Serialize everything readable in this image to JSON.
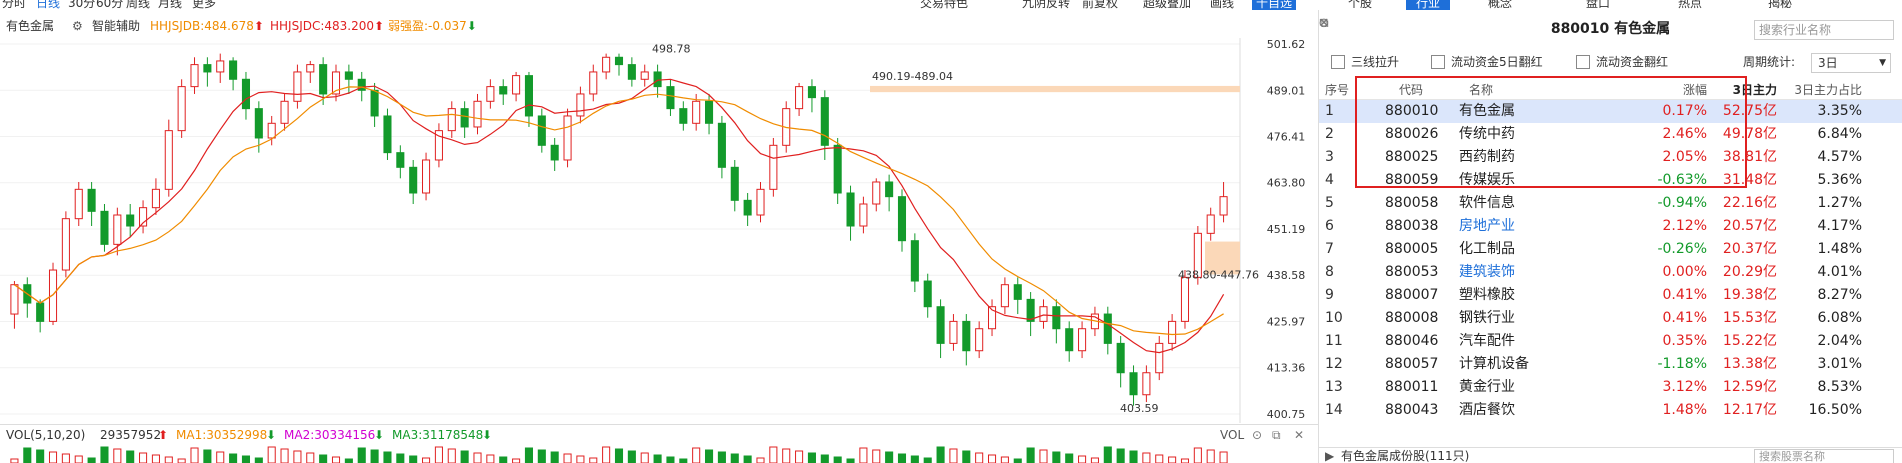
{
  "top_tabs": [
    "分时",
    "日线",
    "30分",
    "60分",
    "周线",
    "月线",
    "更多"
  ],
  "top_tab_active": 1,
  "top_tools": [
    "交易特色",
    "九阴反转",
    "前复权",
    "超级叠加",
    "画线",
    "十自选"
  ],
  "right_tabs": [
    "个股",
    "行业",
    "概念",
    "盘口",
    "热点",
    "揭秘"
  ],
  "right_tab_active": 1,
  "chart_header": {
    "name": "有色金属",
    "assist": "智能辅助",
    "ind1": "HHJSJDB:484.678",
    "ind2": "HHJSJDC:483.200",
    "ind3": "弱强盈:-0.037"
  },
  "vol_header": {
    "label": "VOL(5,10,20)",
    "vol": "29357952",
    "ma1": "MA1:30352998",
    "ma2": "MA2:30334156",
    "ma3": "MA3:31178548",
    "right_label": "VOL"
  },
  "chart_data": {
    "type": "candlestick",
    "price_axis": [
      "501.62",
      "489.01",
      "476.41",
      "463.80",
      "451.19",
      "438.58",
      "425.97",
      "413.36",
      "400.75"
    ],
    "ylim": [
      400.75,
      501.62
    ],
    "annotations": {
      "high_label": "498.78",
      "low_label": "403.59",
      "zone1": "490.19-489.04",
      "zone2": "438.80-447.76"
    },
    "candles": [
      [
        428,
        436,
        424,
        437
      ],
      [
        436,
        431,
        427,
        438
      ],
      [
        431,
        426,
        423,
        432
      ],
      [
        426,
        440,
        425,
        442
      ],
      [
        440,
        454,
        438,
        456
      ],
      [
        454,
        462,
        452,
        464
      ],
      [
        462,
        456,
        452,
        464
      ],
      [
        456,
        447,
        445,
        458
      ],
      [
        447,
        455,
        444,
        457
      ],
      [
        455,
        452,
        449,
        458
      ],
      [
        452,
        457,
        450,
        459
      ],
      [
        457,
        462,
        455,
        465
      ],
      [
        462,
        478,
        460,
        481
      ],
      [
        478,
        490,
        476,
        492
      ],
      [
        490,
        496,
        488,
        498
      ],
      [
        496,
        494,
        490,
        498
      ],
      [
        494,
        497,
        491,
        499
      ],
      [
        497,
        492,
        489,
        498
      ],
      [
        492,
        484,
        481,
        494
      ],
      [
        484,
        476,
        472,
        486
      ],
      [
        476,
        480,
        474,
        482
      ],
      [
        480,
        486,
        478,
        488
      ],
      [
        486,
        494,
        484,
        496
      ],
      [
        494,
        496,
        491,
        497
      ],
      [
        496,
        488,
        485,
        498
      ],
      [
        488,
        494,
        486,
        496
      ],
      [
        494,
        492,
        488,
        496
      ],
      [
        492,
        489,
        486,
        494
      ],
      [
        489,
        482,
        479,
        491
      ],
      [
        482,
        472,
        470,
        484
      ],
      [
        472,
        468,
        465,
        474
      ],
      [
        468,
        461,
        458,
        470
      ],
      [
        461,
        470,
        459,
        472
      ],
      [
        470,
        478,
        468,
        480
      ],
      [
        478,
        484,
        476,
        486
      ],
      [
        484,
        479,
        476,
        486
      ],
      [
        479,
        486,
        477,
        488
      ],
      [
        486,
        490,
        484,
        492
      ],
      [
        490,
        488,
        485,
        492
      ],
      [
        488,
        493,
        486,
        494
      ],
      [
        493,
        482,
        479,
        494
      ],
      [
        482,
        474,
        472,
        484
      ],
      [
        474,
        470,
        467,
        476
      ],
      [
        470,
        482,
        468,
        484
      ],
      [
        482,
        488,
        480,
        490
      ],
      [
        488,
        494,
        486,
        496
      ],
      [
        494,
        498,
        492,
        499
      ],
      [
        498,
        496,
        493,
        499
      ],
      [
        496,
        492,
        490,
        498
      ],
      [
        492,
        494,
        490,
        496
      ],
      [
        494,
        490,
        487,
        496
      ],
      [
        490,
        484,
        482,
        492
      ],
      [
        484,
        480,
        478,
        486
      ],
      [
        480,
        486,
        478,
        488
      ],
      [
        486,
        480,
        477,
        488
      ],
      [
        480,
        468,
        465,
        482
      ],
      [
        468,
        459,
        456,
        470
      ],
      [
        459,
        455,
        452,
        461
      ],
      [
        455,
        462,
        453,
        464
      ],
      [
        462,
        474,
        460,
        476
      ],
      [
        474,
        484,
        472,
        486
      ],
      [
        484,
        490,
        482,
        491
      ],
      [
        490,
        487,
        483,
        492
      ],
      [
        487,
        474,
        470,
        489
      ],
      [
        474,
        461,
        458,
        476
      ],
      [
        461,
        452,
        448,
        463
      ],
      [
        452,
        458,
        450,
        460
      ],
      [
        458,
        464,
        456,
        465
      ],
      [
        464,
        460,
        456,
        466
      ],
      [
        460,
        448,
        445,
        462
      ],
      [
        448,
        437,
        434,
        450
      ],
      [
        437,
        430,
        427,
        439
      ],
      [
        430,
        420,
        416,
        432
      ],
      [
        420,
        426,
        418,
        428
      ],
      [
        426,
        418,
        414,
        428
      ],
      [
        418,
        424,
        416,
        426
      ],
      [
        424,
        430,
        422,
        432
      ],
      [
        430,
        436,
        428,
        438
      ],
      [
        436,
        432,
        428,
        438
      ],
      [
        432,
        426,
        422,
        434
      ],
      [
        426,
        430,
        424,
        432
      ],
      [
        430,
        424,
        420,
        432
      ],
      [
        424,
        418,
        415,
        426
      ],
      [
        418,
        424,
        416,
        426
      ],
      [
        424,
        428,
        422,
        430
      ],
      [
        428,
        420,
        417,
        430
      ],
      [
        420,
        412,
        408,
        422
      ],
      [
        412,
        406,
        403,
        414
      ],
      [
        406,
        412,
        404,
        414
      ],
      [
        412,
        420,
        410,
        422
      ],
      [
        420,
        426,
        418,
        428
      ],
      [
        426,
        438,
        424,
        440
      ],
      [
        438,
        450,
        436,
        452
      ],
      [
        450,
        455,
        448,
        457
      ],
      [
        455,
        460,
        453,
        464
      ]
    ]
  },
  "right_panel": {
    "title": "880010 有色金属",
    "search_placeholder": "搜索行业名称",
    "filters": [
      "三线拉升",
      "流动资金5日翻红",
      "流动资金翻红"
    ],
    "period_label": "周期统计:",
    "period_value": "3日",
    "headers": [
      "序号",
      "代码",
      "名称",
      "涨幅",
      "3日主力",
      "3日主力占比"
    ],
    "rows": [
      {
        "idx": "1",
        "code": "880010",
        "name": "有色金属",
        "chg": "0.17%",
        "net": "52.75亿",
        "pct": "3.35%",
        "dir": "up",
        "link": false
      },
      {
        "idx": "2",
        "code": "880026",
        "name": "传统中药",
        "chg": "2.46%",
        "net": "49.78亿",
        "pct": "6.84%",
        "dir": "up",
        "link": false
      },
      {
        "idx": "3",
        "code": "880025",
        "name": "西药制药",
        "chg": "2.05%",
        "net": "38.81亿",
        "pct": "4.57%",
        "dir": "up",
        "link": false
      },
      {
        "idx": "4",
        "code": "880059",
        "name": "传媒娱乐",
        "chg": "-0.63%",
        "net": "31.48亿",
        "pct": "5.36%",
        "dir": "down",
        "link": false
      },
      {
        "idx": "5",
        "code": "880058",
        "name": "软件信息",
        "chg": "-0.94%",
        "net": "22.16亿",
        "pct": "1.27%",
        "dir": "down",
        "link": false
      },
      {
        "idx": "6",
        "code": "880038",
        "name": "房地产业",
        "chg": "2.12%",
        "net": "20.57亿",
        "pct": "4.17%",
        "dir": "up",
        "link": true
      },
      {
        "idx": "7",
        "code": "880005",
        "name": "化工制品",
        "chg": "-0.26%",
        "net": "20.37亿",
        "pct": "1.48%",
        "dir": "down",
        "link": false
      },
      {
        "idx": "8",
        "code": "880053",
        "name": "建筑装饰",
        "chg": "0.00%",
        "net": "20.29亿",
        "pct": "4.01%",
        "dir": "up",
        "link": true
      },
      {
        "idx": "9",
        "code": "880007",
        "name": "塑料橡胶",
        "chg": "0.41%",
        "net": "19.38亿",
        "pct": "8.27%",
        "dir": "up",
        "link": false
      },
      {
        "idx": "10",
        "code": "880008",
        "name": "钢铁行业",
        "chg": "0.41%",
        "net": "15.53亿",
        "pct": "6.08%",
        "dir": "up",
        "link": false
      },
      {
        "idx": "11",
        "code": "880046",
        "name": "汽车配件",
        "chg": "0.35%",
        "net": "15.22亿",
        "pct": "2.04%",
        "dir": "up",
        "link": false
      },
      {
        "idx": "12",
        "code": "880057",
        "name": "计算机设备",
        "chg": "-1.18%",
        "net": "13.38亿",
        "pct": "3.01%",
        "dir": "down",
        "link": false
      },
      {
        "idx": "13",
        "code": "880011",
        "name": "黄金行业",
        "chg": "3.12%",
        "net": "12.59亿",
        "pct": "8.53%",
        "dir": "up",
        "link": false
      },
      {
        "idx": "14",
        "code": "880043",
        "name": "酒店餐饮",
        "chg": "1.48%",
        "net": "12.17亿",
        "pct": "16.50%",
        "dir": "up",
        "link": false
      }
    ],
    "bottom_label": "有色金属成份股(111只)",
    "bottom_search_placeholder": "搜索股票名称"
  },
  "colors": {
    "up": "#e02020",
    "down": "#139a2b",
    "accent": "#1e6fd9",
    "ma_short": "#e02020",
    "ma_long": "#f08c00"
  }
}
